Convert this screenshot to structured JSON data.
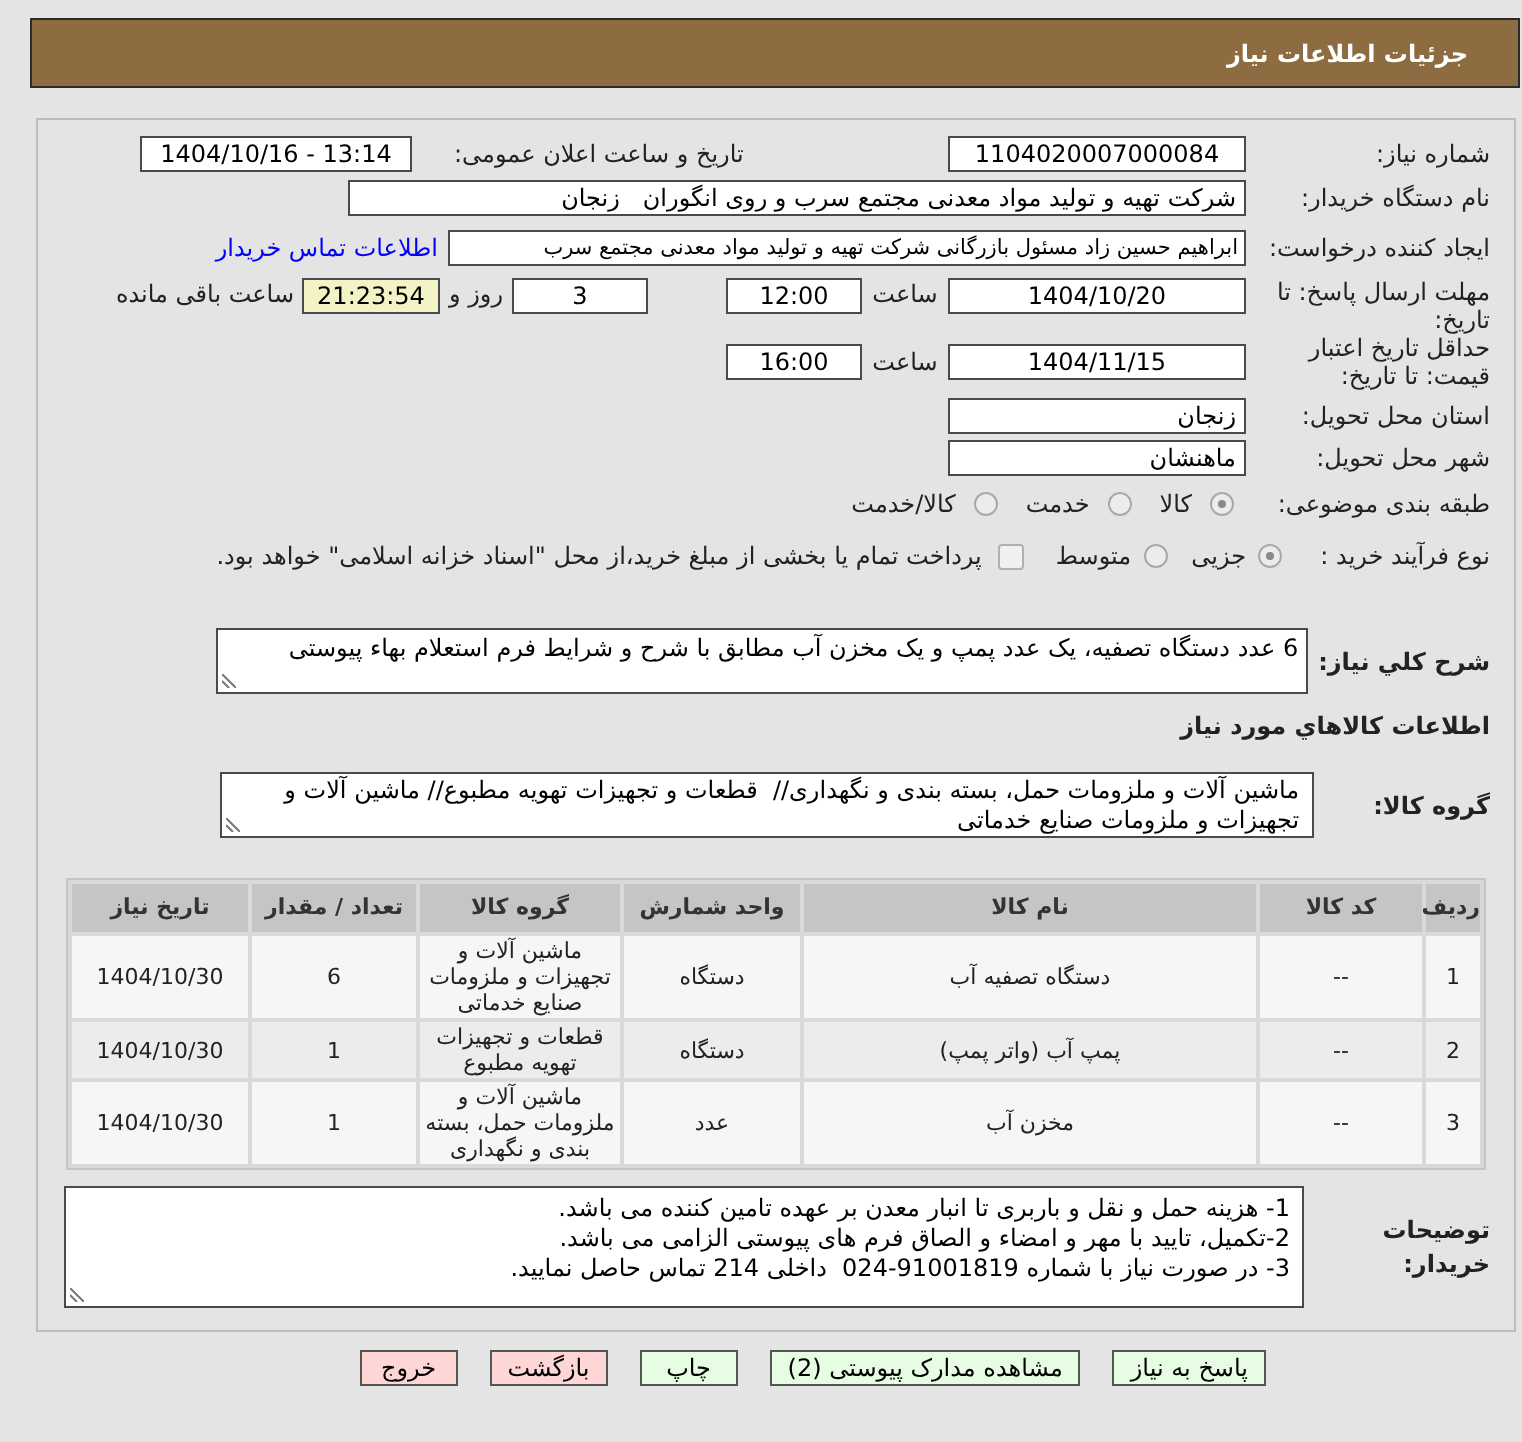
{
  "header": {
    "title": "جزئیات اطلاعات نیاز"
  },
  "form": {
    "need_number": {
      "label": "شماره نیاز:",
      "value": "1104020007000084"
    },
    "announce": {
      "label": "تاریخ و ساعت اعلان عمومی:",
      "value": "1404/10/16 - 13:14"
    },
    "buyer_org": {
      "label": "نام دستگاه خریدار:",
      "value": "شرکت تهیه و تولید مواد معدنی مجتمع سرب و روی انگوران   زنجان"
    },
    "requester": {
      "label": "ایجاد کننده درخواست:",
      "value": "ابراهیم حسین زاد مسئول بازرگانی شرکت تهیه و تولید مواد معدنی مجتمع سرب",
      "contact_link": "اطلاعات تماس خریدار"
    },
    "reply_deadline": {
      "label": "مهلت ارسال پاسخ: تا تاریخ:",
      "date": "1404/10/20",
      "time_label": "ساعت",
      "time": "12:00",
      "days": "3",
      "days_label": "روز و",
      "remaining": "21:23:54",
      "remaining_label": "ساعت باقی مانده"
    },
    "price_validity": {
      "label": "حداقل تاریخ اعتبار قیمت: تا تاریخ:",
      "date": "1404/11/15",
      "time_label": "ساعت",
      "time": "16:00"
    },
    "province": {
      "label": "استان محل تحویل:",
      "value": "زنجان"
    },
    "city": {
      "label": "شهر محل تحویل:",
      "value": "ماهنشان"
    },
    "category": {
      "label": "طبقه بندی موضوعی:",
      "options": [
        {
          "label": "کالا",
          "selected": true
        },
        {
          "label": "خدمت",
          "selected": false
        },
        {
          "label": "کالا/خدمت",
          "selected": false
        }
      ]
    },
    "purchase_type": {
      "label": "نوع فرآیند خرید :",
      "options": [
        {
          "label": "جزیی",
          "selected": true
        },
        {
          "label": "متوسط",
          "selected": false
        }
      ],
      "treasury": {
        "checked": false,
        "label": "پرداخت تمام یا بخشی از مبلغ خرید،از محل \"اسناد خزانه اسلامی\" خواهد بود."
      }
    }
  },
  "description": {
    "label": "شرح کلي نياز:",
    "value": "6 عدد دستگاه تصفیه، یک عدد پمپ و یک مخزن آب مطابق با شرح و شرایط فرم استعلام بهاء پیوستی"
  },
  "goods": {
    "title": "اطلاعات کالاهاي مورد نياز",
    "group": {
      "label": "گروه کالا:",
      "value": "ماشین آلات و ملزومات حمل، بسته بندی و نگهداری//  قطعات و تجهیزات تهویه مطبوع// ماشین آلات و تجهیزات و ملزومات صنایع خدماتی"
    },
    "table": {
      "columns": [
        "ردیف",
        "کد کالا",
        "نام کالا",
        "واحد شمارش",
        "گروه کالا",
        "تعداد / مقدار",
        "تاریخ نیاز"
      ],
      "rows": [
        [
          "1",
          "--",
          "دستگاه تصفیه آب",
          "دستگاه",
          "ماشین آلات و تجهیزات و ملزومات صنایع خدماتی",
          "6",
          "1404/10/30"
        ],
        [
          "2",
          "--",
          "پمپ آب (واتر پمپ)",
          "دستگاه",
          "قطعات و تجهیزات تهویه مطبوع",
          "1",
          "1404/10/30"
        ],
        [
          "3",
          "--",
          "مخزن آب",
          "عدد",
          "ماشین آلات و ملزومات حمل، بسته بندی و نگهداری",
          "1",
          "1404/10/30"
        ]
      ]
    }
  },
  "buyer_notes": {
    "label": "توضیحات خریدار:",
    "lines": [
      "1- هزینه حمل و نقل و باربری تا انبار معدن بر عهده تامین کننده می باشد.",
      "2-تکمیل، تایید با مهر و امضاء و الصاق فرم های پیوستی الزامی می باشد.",
      "3- در صورت نیاز با شماره 91001819-024  داخلی 214 تماس حاصل نمایید."
    ]
  },
  "buttons": [
    {
      "label": "پاسخ به نیاز",
      "kind": "action"
    },
    {
      "label": "مشاهده مدارک پیوستی (2)",
      "kind": "action"
    },
    {
      "label": "چاپ",
      "kind": "action"
    },
    {
      "label": "بازگشت",
      "kind": "leave"
    },
    {
      "label": "خروج",
      "kind": "leave"
    }
  ]
}
